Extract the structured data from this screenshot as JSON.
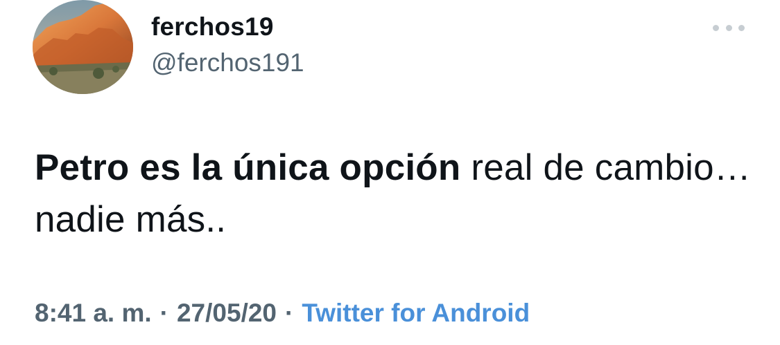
{
  "tweet": {
    "author": {
      "display_name": "ferchos19",
      "handle": "@ferchos191",
      "avatar_icon": "desert-rock-avatar"
    },
    "more_icon": "more-options-icon",
    "text_bold": "Petro es la única opción",
    "text_rest": " real de cambio…nadie más..",
    "time": "8:41 a. m.",
    "separator": "·",
    "date": "27/05/20",
    "source": "Twitter for Android"
  },
  "colors": {
    "text_primary": "#0f1419",
    "text_secondary": "#536471",
    "link": "#4a90d9",
    "more_dots": "#c7cdd2"
  }
}
